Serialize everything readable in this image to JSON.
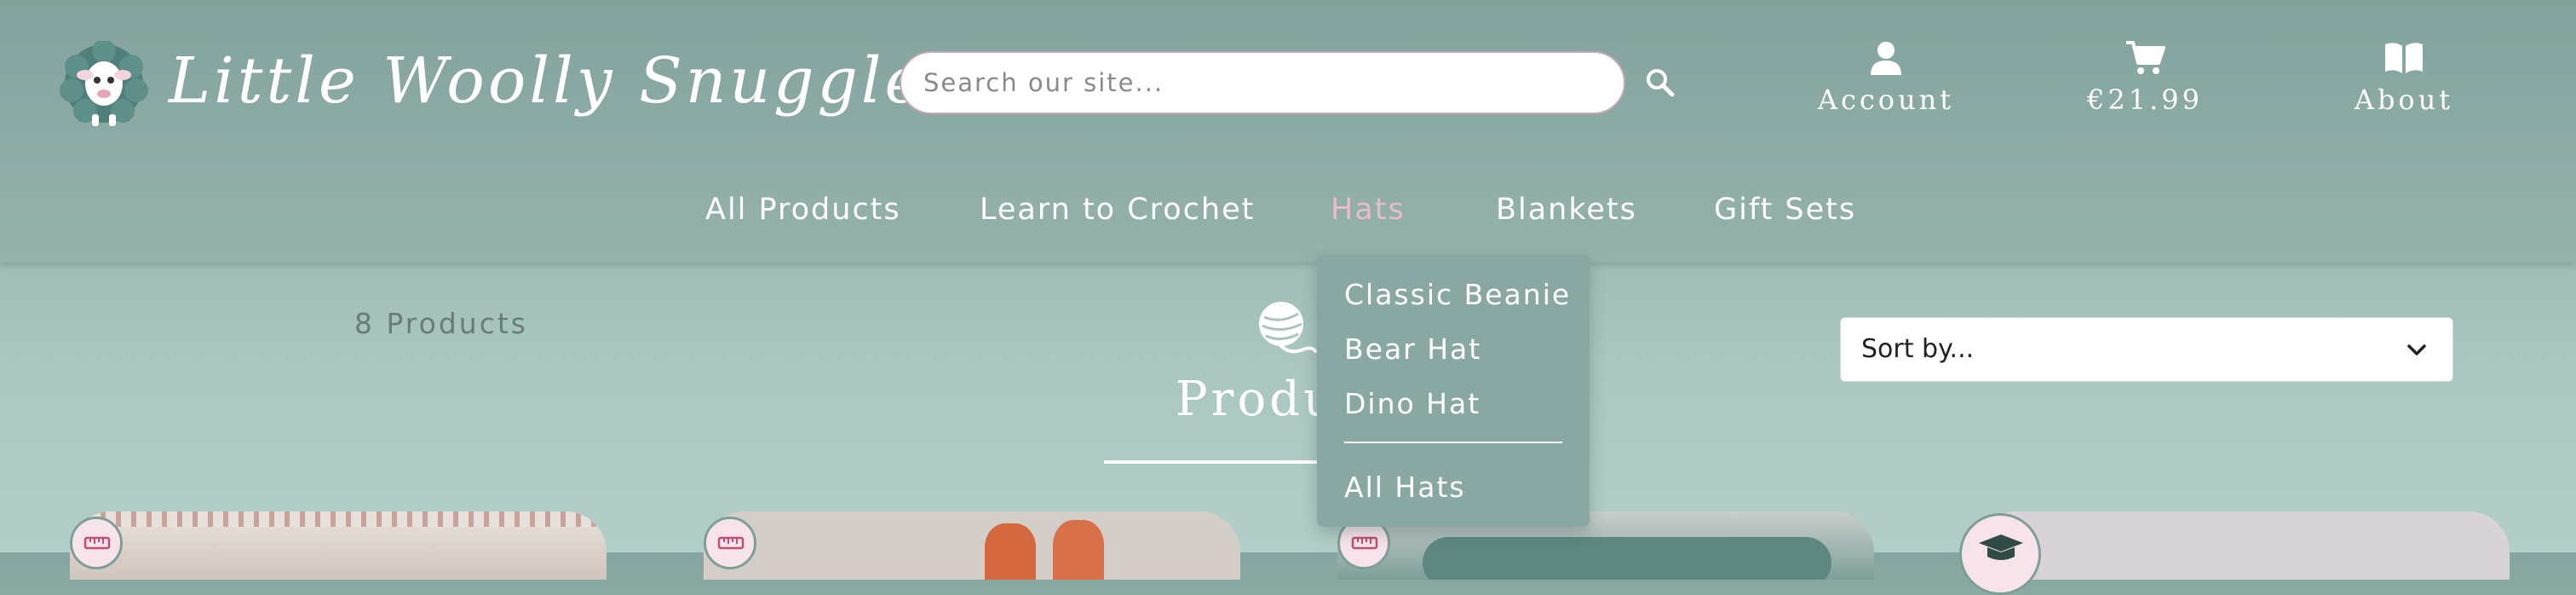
{
  "header": {
    "logo_text": "Little Woolly Snuggles",
    "search": {
      "placeholder": "Search our site..."
    },
    "links": [
      {
        "label": "Account",
        "icon": "account-icon"
      },
      {
        "label": "€21.99",
        "icon": "cart-icon"
      },
      {
        "label": "About",
        "icon": "book-icon"
      }
    ]
  },
  "nav": {
    "items": [
      "All Products",
      "Learn to Crochet",
      "Hats",
      "Blankets",
      "Gift Sets"
    ],
    "active": "Hats",
    "dropdown": [
      "Classic Beanie",
      "Bear Hat",
      "Dino Hat",
      "All Hats"
    ]
  },
  "main": {
    "count": "8 Products",
    "title": "Products",
    "sort": {
      "selected": "Sort by..."
    }
  },
  "colors": {
    "accent_pink": "#e9bcc9",
    "teal": "#86a6a1",
    "dropdown_bg": "#8aa8a3"
  }
}
